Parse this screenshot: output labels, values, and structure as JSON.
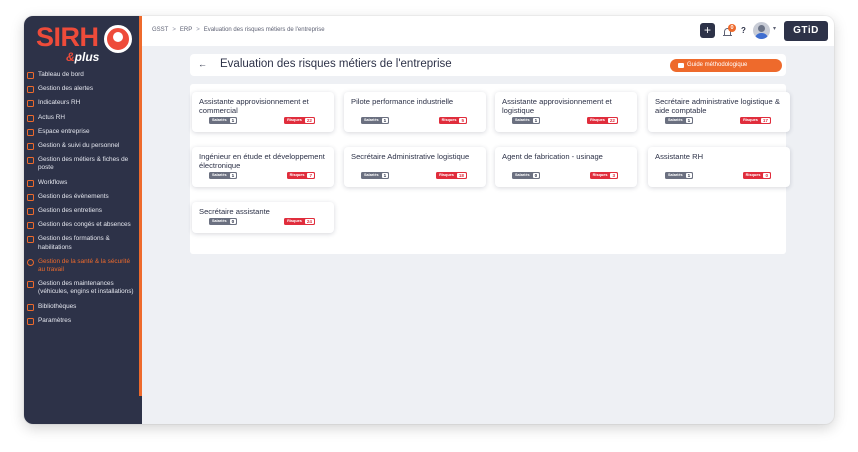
{
  "logo": {
    "name_a": "SI",
    "name_b": "RH",
    "sub_amp": "&",
    "sub": "plus"
  },
  "sidebar": {
    "items": [
      {
        "label": "Tableau de bord"
      },
      {
        "label": "Gestion des alertes"
      },
      {
        "label": "Indicateurs RH"
      },
      {
        "label": "Actus RH"
      },
      {
        "label": "Espace entreprise"
      },
      {
        "label": "Gestion & suivi du personnel"
      },
      {
        "label": "Gestion des métiers & fiches de poste"
      },
      {
        "label": "Workflows"
      },
      {
        "label": "Gestion des évènements"
      },
      {
        "label": "Gestion des entretiens"
      },
      {
        "label": "Gestion des congés et absences"
      },
      {
        "label": "Gestion des formations & habilitations"
      },
      {
        "label": "Gestion de la santé & la sécurité au travail",
        "active": true
      },
      {
        "label": "Gestion des maintenances (véhicules, engins et installations)"
      },
      {
        "label": "Bibliothèques"
      },
      {
        "label": "Paramètres"
      }
    ]
  },
  "breadcrumb": {
    "item1": "GSST",
    "sep": ">",
    "item2": "ERP",
    "item3": "Evaluation des risques métiers de l'entreprise"
  },
  "topbar": {
    "plus": "+",
    "notif_count": "0",
    "help": "?",
    "chevron": "▾",
    "brand": "GTiD"
  },
  "header": {
    "back": "←",
    "title": "Evaluation des risques métiers de l'entreprise",
    "guide_label": "Guide méthodologique"
  },
  "badges": {
    "salaries_label": "Salariés",
    "risques_label": "Risques"
  },
  "cards": [
    {
      "title": "Assistante approvisionnement et commercial",
      "salaries": "1",
      "risques": "22"
    },
    {
      "title": "Pilote performance industrielle",
      "salaries": "1",
      "risques": "5"
    },
    {
      "title": "Assistante approvisionnement et logistique",
      "salaries": "1",
      "risques": "22"
    },
    {
      "title": "Secrétaire administrative logistique & aide comptable",
      "salaries": "1",
      "risques": "17"
    },
    {
      "title": "Ingénieur en étude et développement électronique",
      "salaries": "1",
      "risques": "7"
    },
    {
      "title": "Secrétaire Administrative logistique",
      "salaries": "1",
      "risques": "18"
    },
    {
      "title": "Agent de fabrication - usinage",
      "salaries": "0",
      "risques": "3"
    },
    {
      "title": "Assistante RH",
      "salaries": "1",
      "risques": "0"
    },
    {
      "title": "Secrétaire assistante",
      "salaries": "0",
      "risques": "24"
    }
  ],
  "colors": {
    "sidebar": "#2d3248",
    "accent": "#ee6a2c",
    "risk": "#e02d3c",
    "salaries": "#6b7080"
  }
}
